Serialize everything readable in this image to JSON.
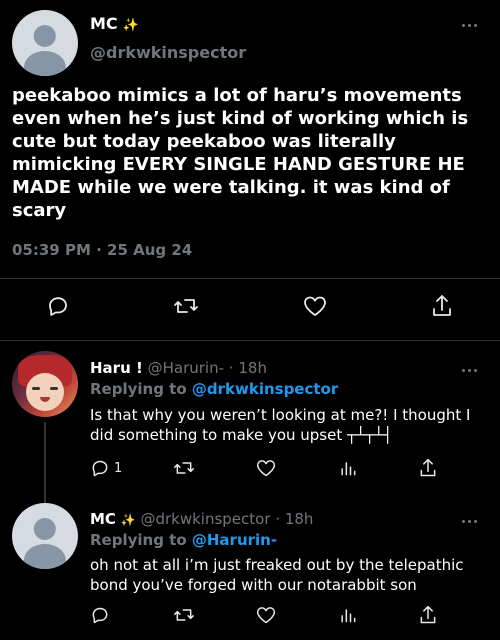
{
  "main_tweet": {
    "name": "MC",
    "name_badge": "✨",
    "handle": "@drkwkinspector",
    "text": "peekaboo mimics a lot of haru’s movements even when he’s just kind of working which is cute but today peekaboo was literally mimicking EVERY SINGLE HAND GESTURE HE MADE while we were talking. it was kind of scary",
    "timestamp": "05:39 PM · 25 Aug 24"
  },
  "reply_1": {
    "name": "Haru !",
    "handle": "@Harurin-",
    "sep": "·",
    "time": "18h",
    "replying_prefix": "Replying to",
    "replying_to": "@drkwkinspector",
    "text": "Is that why you weren’t looking at me?! I thought I did something to make you upset ┬┴┬┴┤",
    "reply_count": "1"
  },
  "reply_2": {
    "name": "MC",
    "name_badge": "✨",
    "handle": "@drkwkinspector",
    "sep": "·",
    "time": "18h",
    "replying_prefix": "Replying to",
    "replying_to": "@Harurin-",
    "text": "oh not at all i’m just freaked out by the telepathic bond you’ve forged with our notarabbit son"
  },
  "icons": {
    "reply": "reply-icon",
    "retweet": "retweet-icon",
    "like": "heart-icon",
    "views": "views-icon",
    "share": "share-icon",
    "more": "more-icon"
  },
  "colors": {
    "background": "#000000",
    "text": "#e7e9ea",
    "muted": "#71767b",
    "accent": "#1d9bf0",
    "divider": "#2f3336"
  }
}
